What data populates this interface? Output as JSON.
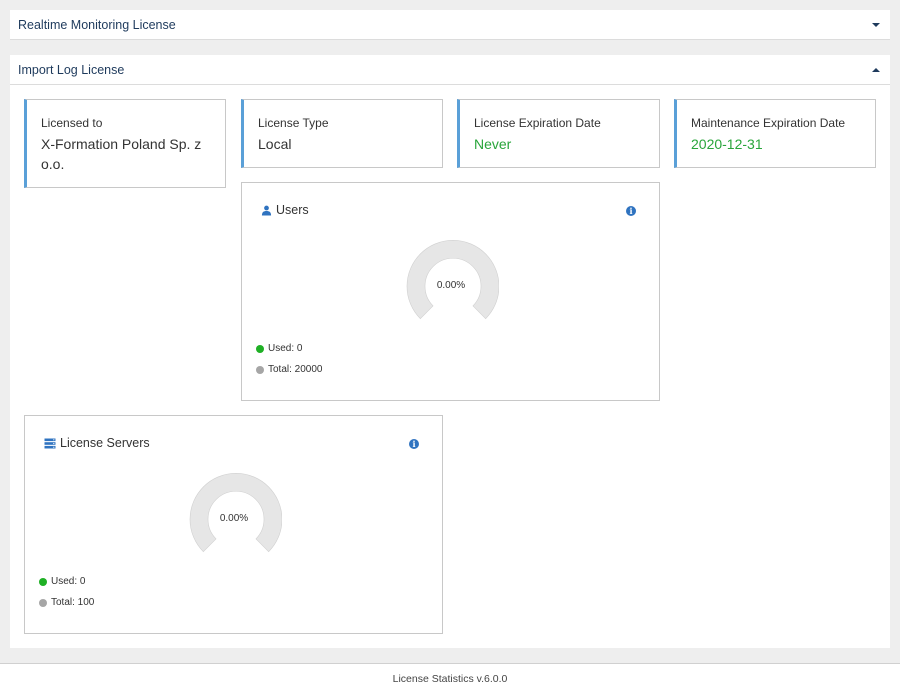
{
  "panels": {
    "realtime": {
      "title": "Realtime Monitoring License"
    },
    "import_log": {
      "title": "Import Log License"
    }
  },
  "info_cards": {
    "licensed_to": {
      "label": "Licensed to",
      "value": "X-Formation Poland Sp. z o.o."
    },
    "license_type": {
      "label": "License Type",
      "value": "Local"
    },
    "license_expiration": {
      "label": "License Expiration Date",
      "value": "Never"
    },
    "maintenance_expiration": {
      "label": "Maintenance Expiration Date",
      "value": "2020-12-31"
    }
  },
  "users_chart": {
    "title": "Users",
    "percent_text": "0.00%",
    "used_label": "Used: 0",
    "total_label": "Total: 20000",
    "used": 0,
    "total": 20000
  },
  "servers_chart": {
    "title": "License Servers",
    "percent_text": "0.00%",
    "used_label": "Used: 0",
    "total_label": "Total: 100",
    "used": 0,
    "total": 100
  },
  "colors": {
    "accent": "#5aa0d8",
    "green": "#28a53a",
    "gauge_track": "#e6e6e6",
    "used_dot": "#1fb025",
    "total_dot": "#a6a6a6",
    "icon_blue": "#2f73c0"
  },
  "footer": {
    "text": "License Statistics v.6.0.0"
  }
}
